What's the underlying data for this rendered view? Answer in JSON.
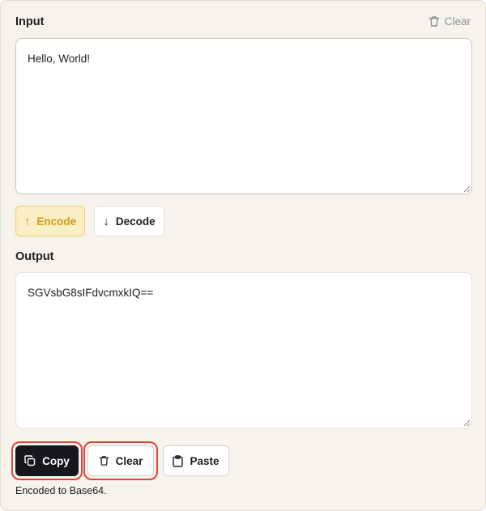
{
  "input": {
    "title": "Input",
    "clear_label": "Clear",
    "value": "Hello, World!"
  },
  "actions": {
    "encode_label": "Encode",
    "encode_arrow": "↑",
    "decode_label": "Decode",
    "decode_arrow": "↓"
  },
  "output": {
    "title": "Output",
    "value": "SGVsbG8sIFdvcmxkIQ=="
  },
  "output_actions": {
    "copy_label": "Copy",
    "clear_label": "Clear",
    "paste_label": "Paste"
  },
  "status": {
    "message": "Encoded to Base64."
  },
  "colors": {
    "panel_bg": "#f6f3ec",
    "accent": "#d49a14",
    "highlight_ring": "#e0463c",
    "primary_button": "#16171b"
  }
}
